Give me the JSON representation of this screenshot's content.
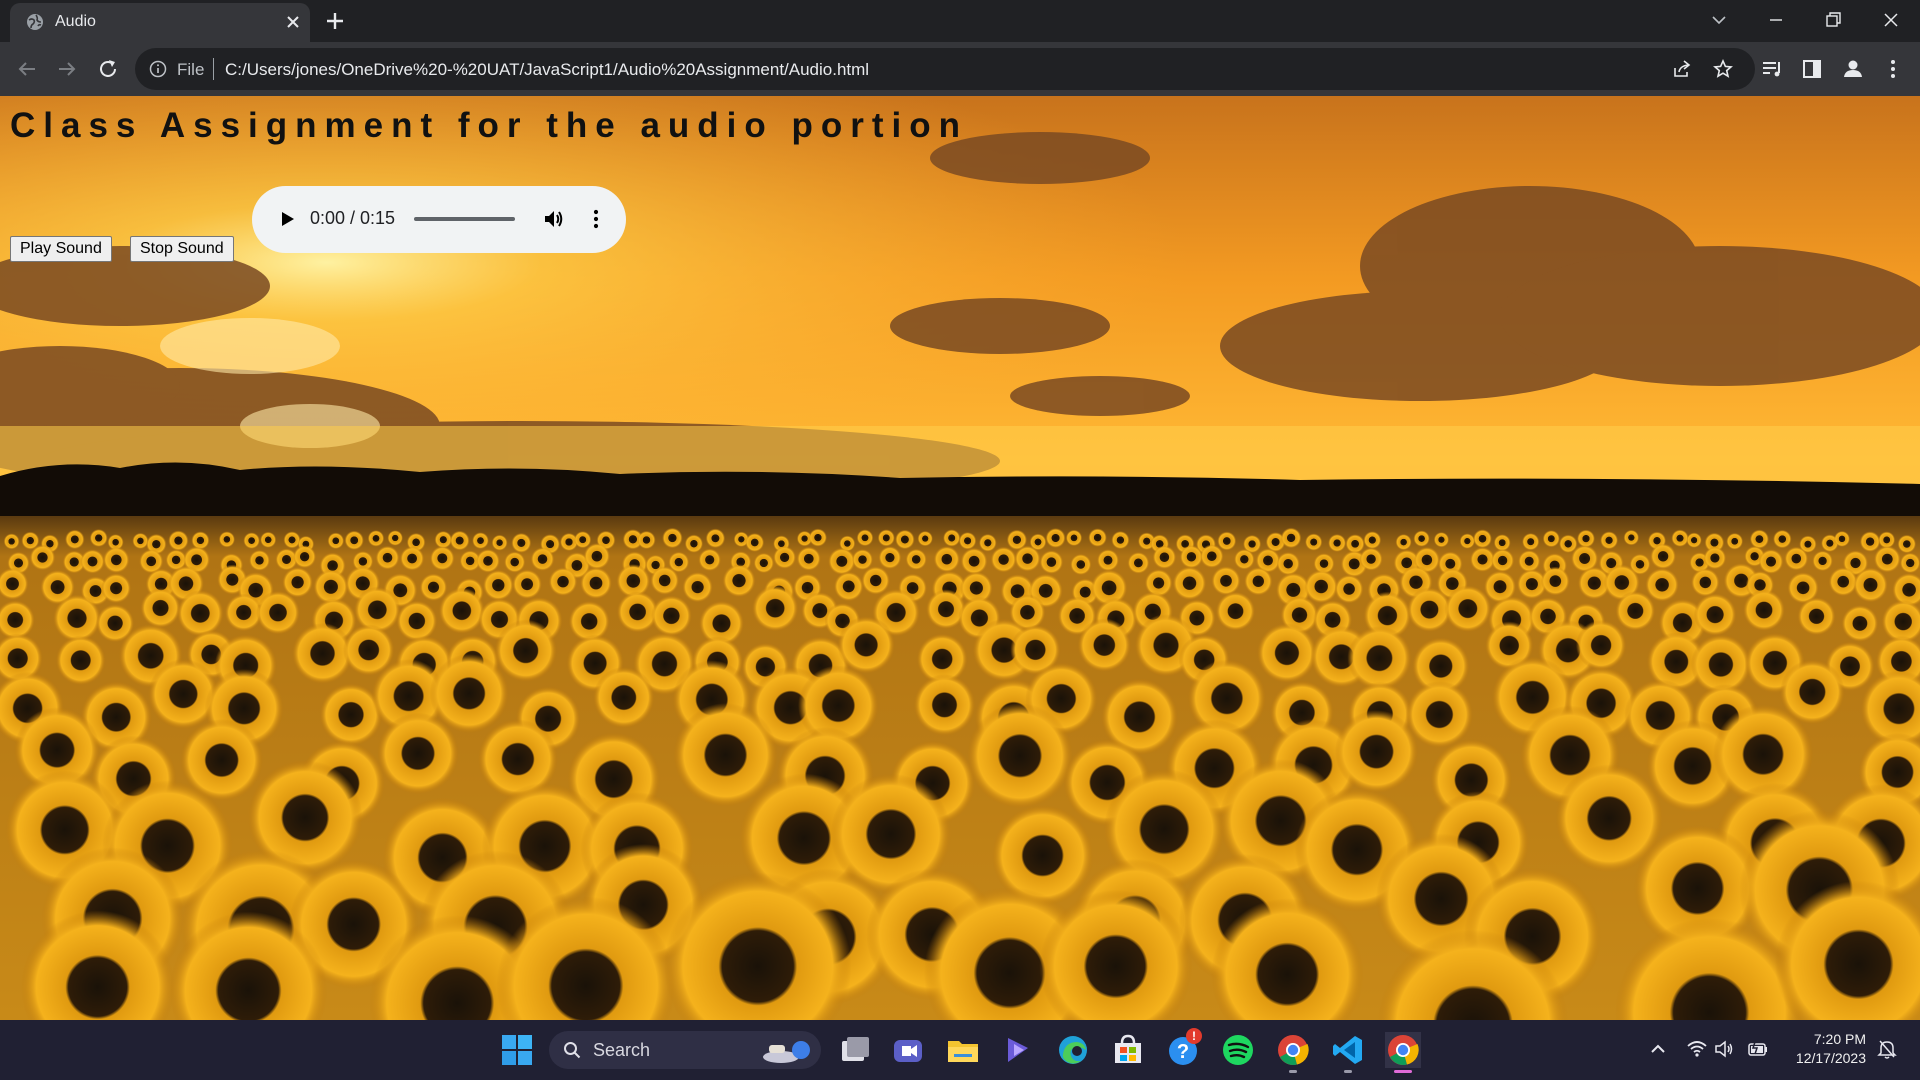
{
  "browser": {
    "tab_title": "Audio",
    "scheme_label": "File",
    "url": "C:/Users/jones/OneDrive%20-%20UAT/JavaScript1/Audio%20Assignment/Audio.html"
  },
  "page": {
    "heading": "Class Assignment for the audio portion",
    "play_button_label": "Play Sound",
    "stop_button_label": "Stop Sound",
    "audio": {
      "time_display": "0:00 / 0:15",
      "progress_fraction": 0
    }
  },
  "taskbar": {
    "search_label": "Search",
    "time": "7:20 PM",
    "date": "12/17/2023",
    "notification_badge": "!"
  },
  "icons": {
    "tab": [
      "globe-icon",
      "close-icon",
      "plus-icon"
    ],
    "window": [
      "chevron-down-icon",
      "minimize-icon",
      "restore-icon",
      "close-icon"
    ],
    "toolbar": [
      "back-arrow-icon",
      "forward-arrow-icon",
      "reload-icon",
      "info-icon",
      "share-icon",
      "star-icon",
      "reading-list-icon",
      "side-panel-icon",
      "profile-icon",
      "kebab-menu-icon"
    ],
    "audio": [
      "play-icon",
      "volume-icon",
      "more-vert-icon"
    ],
    "taskbar": [
      "windows-start-icon",
      "search-icon",
      "task-view-icon",
      "meet-icon",
      "file-explorer-icon",
      "copilot-icon",
      "edge-icon",
      "store-icon",
      "help-icon",
      "spotify-icon",
      "chrome-icon",
      "vscode-icon",
      "chrome-icon",
      "chevron-up-icon",
      "wifi-icon",
      "speaker-icon",
      "battery-icon",
      "notification-bell-icon"
    ]
  },
  "colors": {
    "chrome_frame": "#202124",
    "chrome_toolbar": "#35363a",
    "taskbar": "#202033",
    "sky_top": "#d07a1c",
    "sky_glow": "#ffcf3f",
    "sunflower": "#f2a816"
  }
}
